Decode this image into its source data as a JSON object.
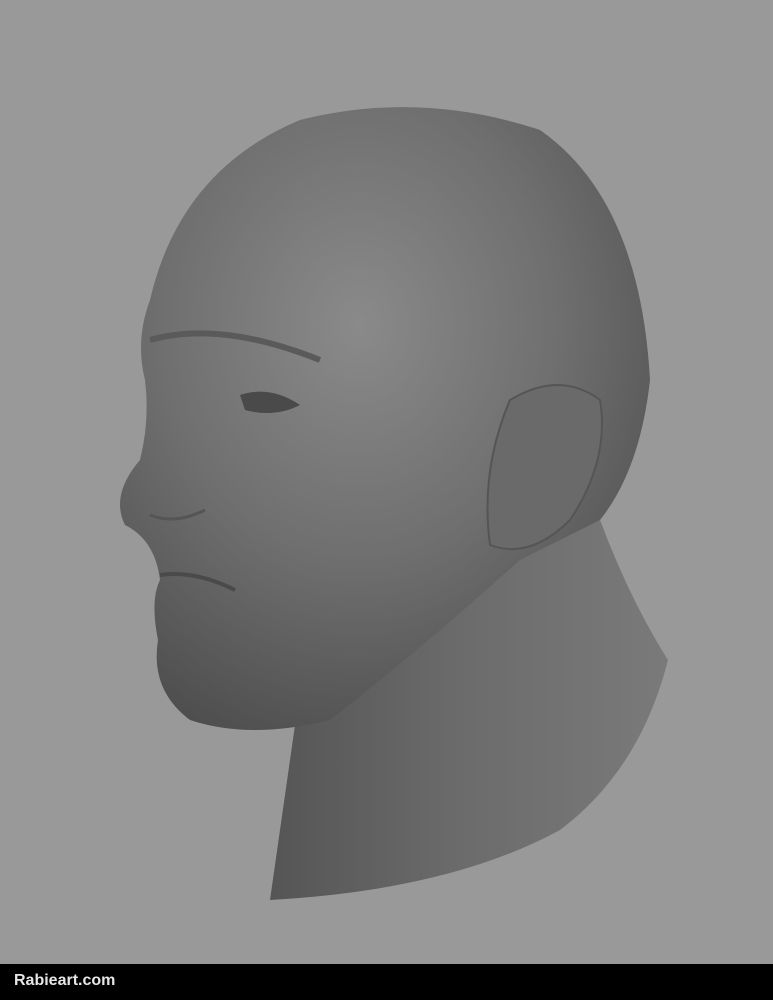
{
  "footer": {
    "watermark": "Rabieart.com"
  },
  "colors": {
    "background": "#999999",
    "footer": "#000000",
    "sculpt": "#6e6e6e"
  }
}
